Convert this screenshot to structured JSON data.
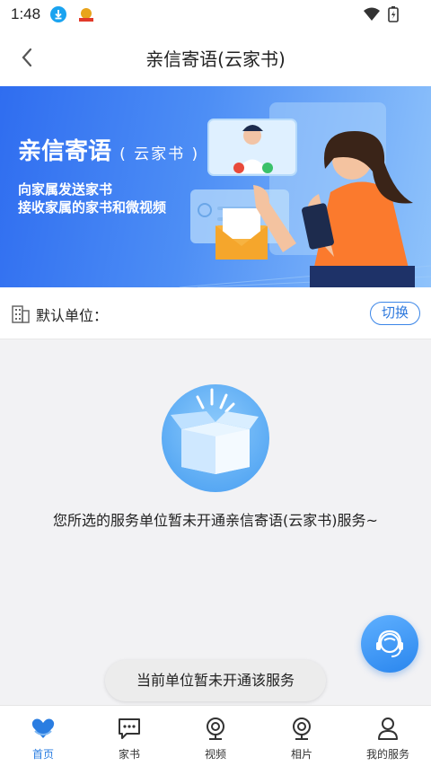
{
  "status": {
    "time": "1:48"
  },
  "header": {
    "title": "亲信寄语(云家书)"
  },
  "banner": {
    "title": "亲信寄语",
    "title_sub": "( 云家书 )",
    "line1": "向家属发送家书",
    "line2": "接收家属的家书和微视频"
  },
  "unit": {
    "label": "默认单位：",
    "switch_label": "切换"
  },
  "empty": {
    "message": "您所选的服务单位暂未开通亲信寄语(云家书)服务~"
  },
  "toast": {
    "message": "当前单位暂未开通该服务"
  },
  "tabs": [
    {
      "label": "首页",
      "icon": "heart-hands-icon",
      "active": true
    },
    {
      "label": "家书",
      "icon": "message-icon"
    },
    {
      "label": "视频",
      "icon": "camera-icon"
    },
    {
      "label": "相片",
      "icon": "camera-icon"
    },
    {
      "label": "我的服务",
      "icon": "person-icon"
    }
  ],
  "colors": {
    "accent": "#2a7de1",
    "banner": "#2f6df0"
  }
}
